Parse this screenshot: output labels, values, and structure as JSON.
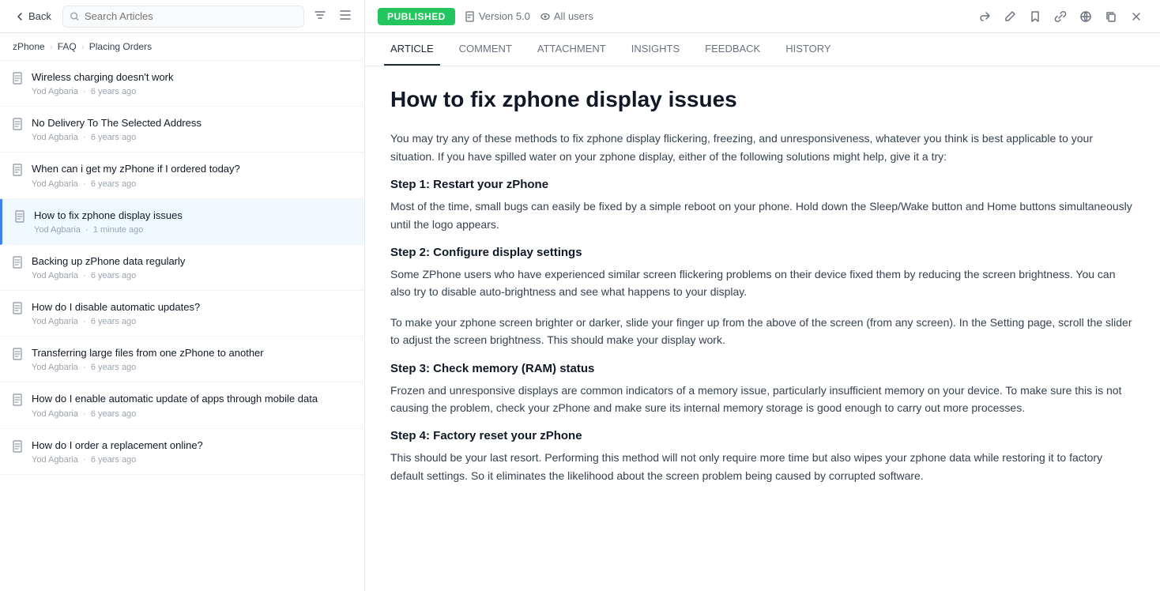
{
  "topbar": {
    "back_label": "Back",
    "search_placeholder": "Search Articles",
    "published_label": "PUBLISHED",
    "version_label": "Version 5.0",
    "users_label": "All users"
  },
  "breadcrumb": {
    "items": [
      "zPhone",
      "FAQ",
      "Placing Orders"
    ]
  },
  "tabs": [
    {
      "id": "article",
      "label": "ARTICLE",
      "active": true
    },
    {
      "id": "comment",
      "label": "COMMENT",
      "active": false
    },
    {
      "id": "attachment",
      "label": "ATTACHMENT",
      "active": false
    },
    {
      "id": "insights",
      "label": "INSIGHTS",
      "active": false
    },
    {
      "id": "feedback",
      "label": "FEEDBACK",
      "active": false
    },
    {
      "id": "history",
      "label": "HISTORY",
      "active": false
    }
  ],
  "articles": [
    {
      "id": 1,
      "title": "Wireless charging doesn't work",
      "author": "Yod Agbaria",
      "time": "6 years ago",
      "active": false
    },
    {
      "id": 2,
      "title": "No Delivery To The Selected Address",
      "author": "Yod Agbaria",
      "time": "6 years ago",
      "active": false
    },
    {
      "id": 3,
      "title": "When can i get my zPhone if I ordered today?",
      "author": "Yod Agbaria",
      "time": "6 years ago",
      "active": false
    },
    {
      "id": 4,
      "title": "How to fix zphone display issues",
      "author": "Yod Agbaria",
      "time": "1 minute ago",
      "active": true
    },
    {
      "id": 5,
      "title": "Backing up zPhone data regularly",
      "author": "Yod Agbaria",
      "time": "6 years ago",
      "active": false
    },
    {
      "id": 6,
      "title": "How do I disable automatic updates?",
      "author": "Yod Agbaria",
      "time": "6 years ago",
      "active": false
    },
    {
      "id": 7,
      "title": "Transferring large files from one zPhone to another",
      "author": "Yod Agbaria",
      "time": "6 years ago",
      "active": false
    },
    {
      "id": 8,
      "title": "How do I enable automatic update of apps through mobile data",
      "author": "Yod Agbaria",
      "time": "6 years ago",
      "active": false
    },
    {
      "id": 9,
      "title": "How do I order a replacement online?",
      "author": "Yod Agbaria",
      "time": "6 years ago",
      "active": false
    }
  ],
  "article": {
    "title": "How to fix zphone display issues",
    "intro": "You may try any of these methods to fix zphone display flickering, freezing, and unresponsiveness, whatever you think is best applicable to your situation. If you have spilled water on your zphone display, either of the following solutions might help, give it a try:",
    "steps": [
      {
        "heading": "Step 1: Restart your zPhone",
        "body": "Most of the time, small bugs can easily be fixed by a simple reboot on your phone. Hold down the Sleep/Wake button and Home buttons simultaneously until the logo appears."
      },
      {
        "heading": "Step 2: Configure display settings",
        "body": "Some ZPhone users who have experienced similar screen flickering problems on their device fixed them by reducing the screen brightness.  You can also try to disable auto-brightness and see what happens to your display.\n\nTo make your zphone screen brighter or darker, slide your finger up from the above of the screen (from any screen). In the Setting page, scroll the slider to adjust the screen brightness. This should make your display work."
      },
      {
        "heading": "Step 3: Check memory (RAM) status",
        "body": "Frozen and unresponsive displays are common indicators of a memory issue, particularly insufficient memory on your device. To make sure this is not causing the problem, check your zPhone and make sure its internal memory storage is good enough to carry out more processes."
      },
      {
        "heading": "Step 4: Factory reset your zPhone",
        "body": "This should be your last resort. Performing this method will not only require more time but also wipes your zphone data while restoring it to factory default settings. So it eliminates the likelihood about the screen problem being caused by corrupted software."
      }
    ]
  }
}
